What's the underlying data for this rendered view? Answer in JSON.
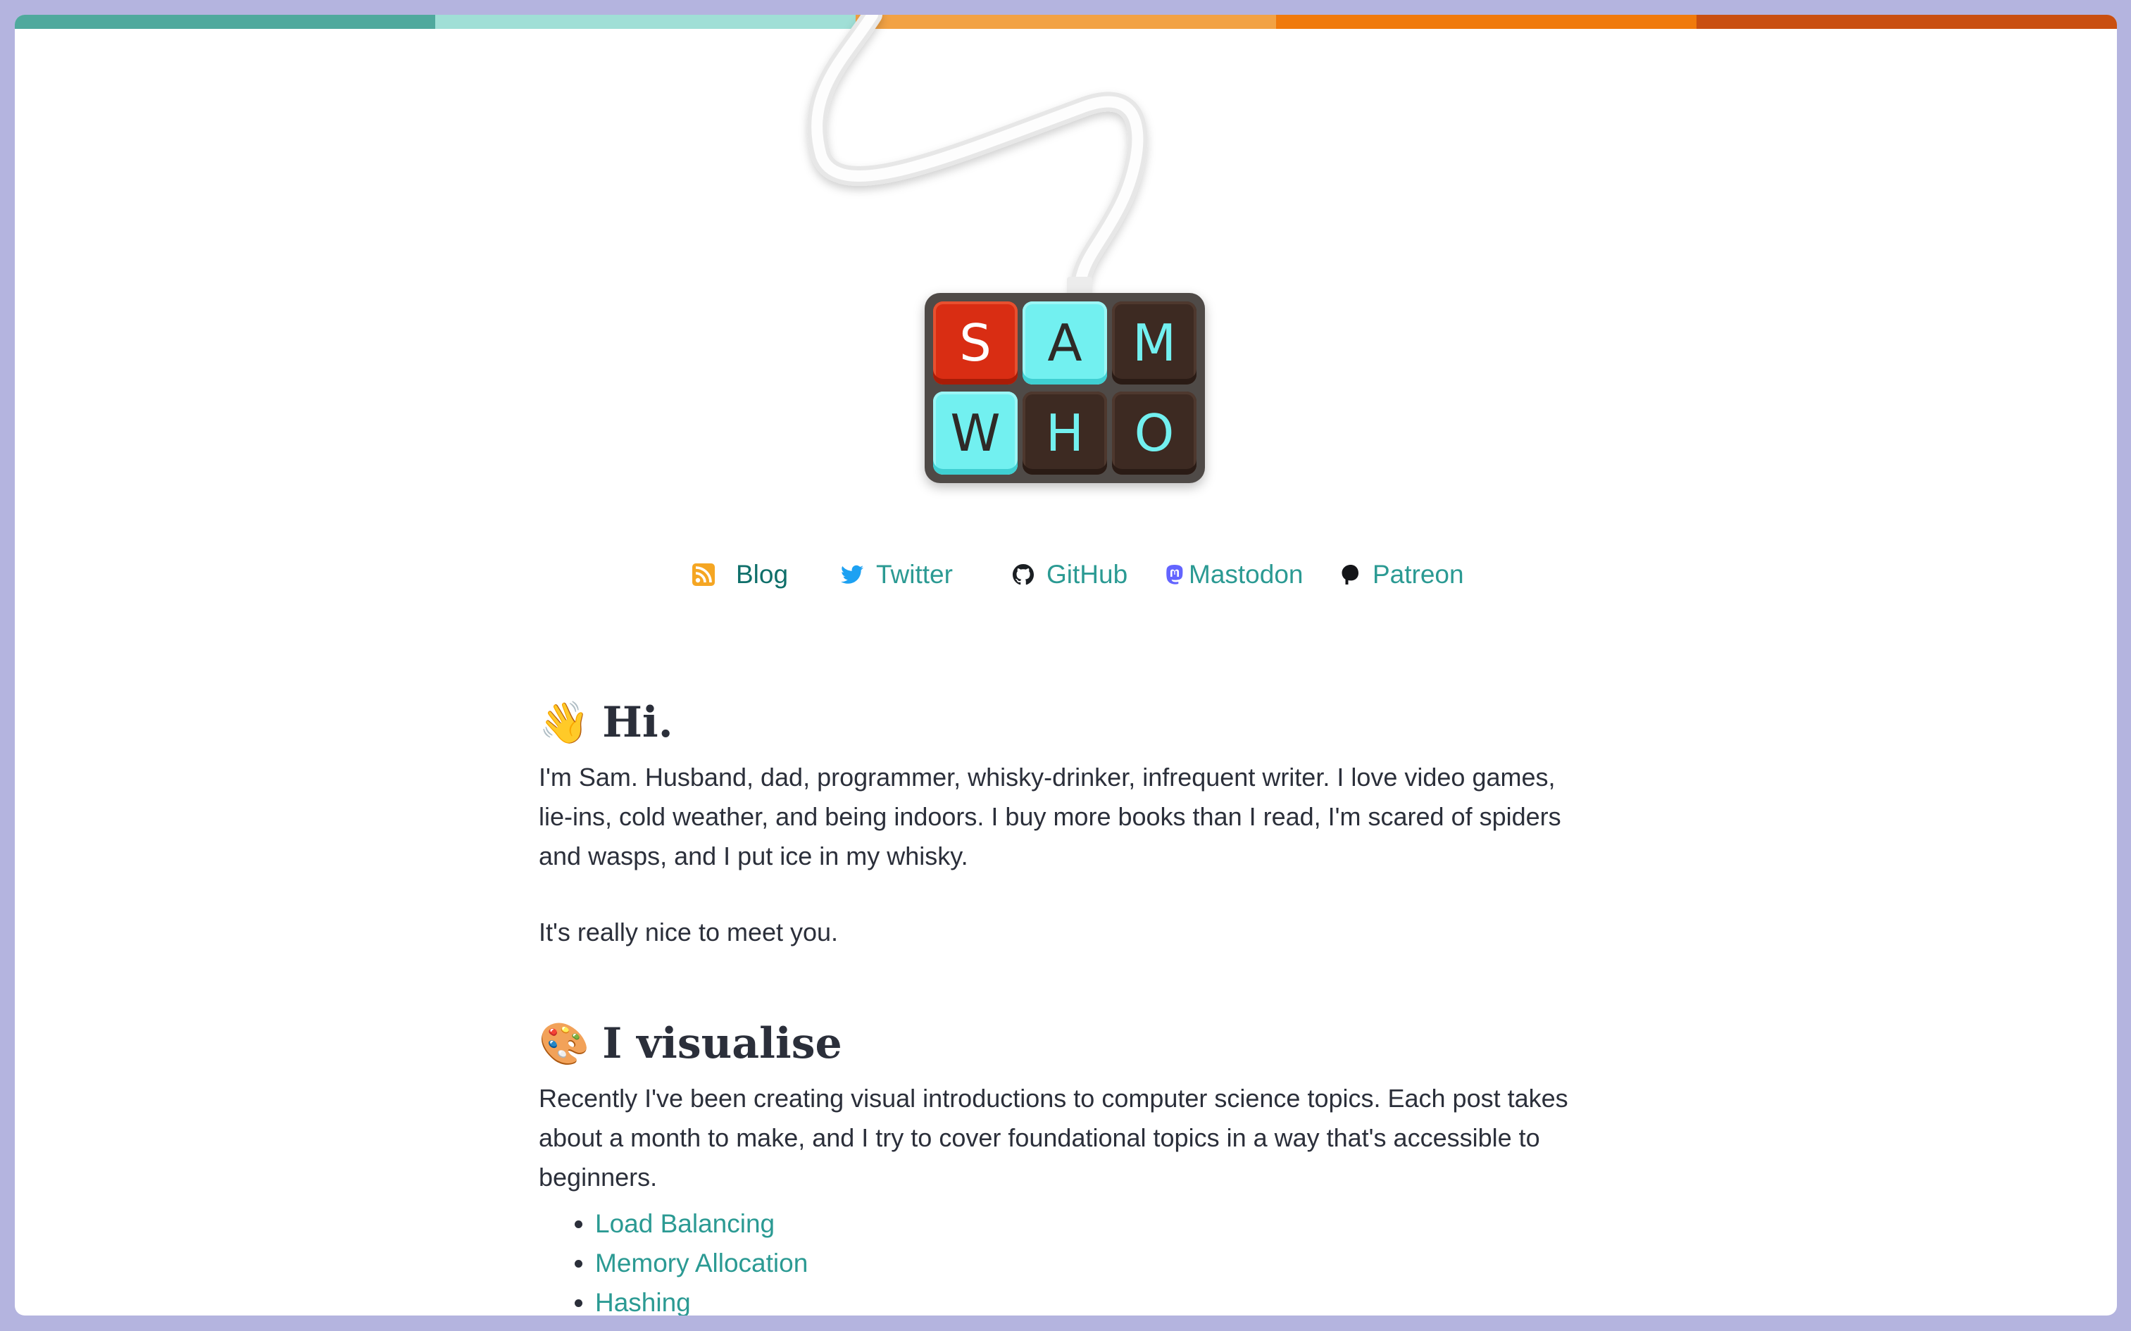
{
  "colors": {
    "stripe": [
      "#4fa99d",
      "#a0dfd6",
      "#f2a244",
      "#f07a0c",
      "#c94f11"
    ],
    "link": "#2b9a93",
    "text": "#2b2f3a",
    "key_red": "#d92d13",
    "key_cyan": "#72f0f0",
    "key_brown": "#3d2a22"
  },
  "logo": {
    "keys": [
      "S",
      "A",
      "M",
      "W",
      "H",
      "O"
    ]
  },
  "social": [
    {
      "label": "Blog",
      "icon": "rss-icon"
    },
    {
      "label": "Twitter",
      "icon": "twitter-icon"
    },
    {
      "label": "GitHub",
      "icon": "github-icon"
    },
    {
      "label": "Mastodon",
      "icon": "mastodon-icon"
    },
    {
      "label": "Patreon",
      "icon": "patreon-icon"
    }
  ],
  "intro": {
    "emoji": "👋",
    "heading": "Hi.",
    "paragraph1": "I'm Sam. Husband, dad, programmer, whisky-drinker, infrequent writer. I love video games, lie-ins, cold weather, and being indoors. I buy more books than I read, I'm scared of spiders and wasps, and I put ice in my whisky.",
    "paragraph2": "It's really nice to meet you."
  },
  "visualise": {
    "emoji": "🎨",
    "heading": "I visualise",
    "paragraph": "Recently I've been creating visual introductions to computer science topics. Each post takes about a month to make, and I try to cover foundational topics in a way that's accessible to beginners.",
    "posts": [
      "Load Balancing",
      "Memory Allocation",
      "Hashing"
    ]
  }
}
